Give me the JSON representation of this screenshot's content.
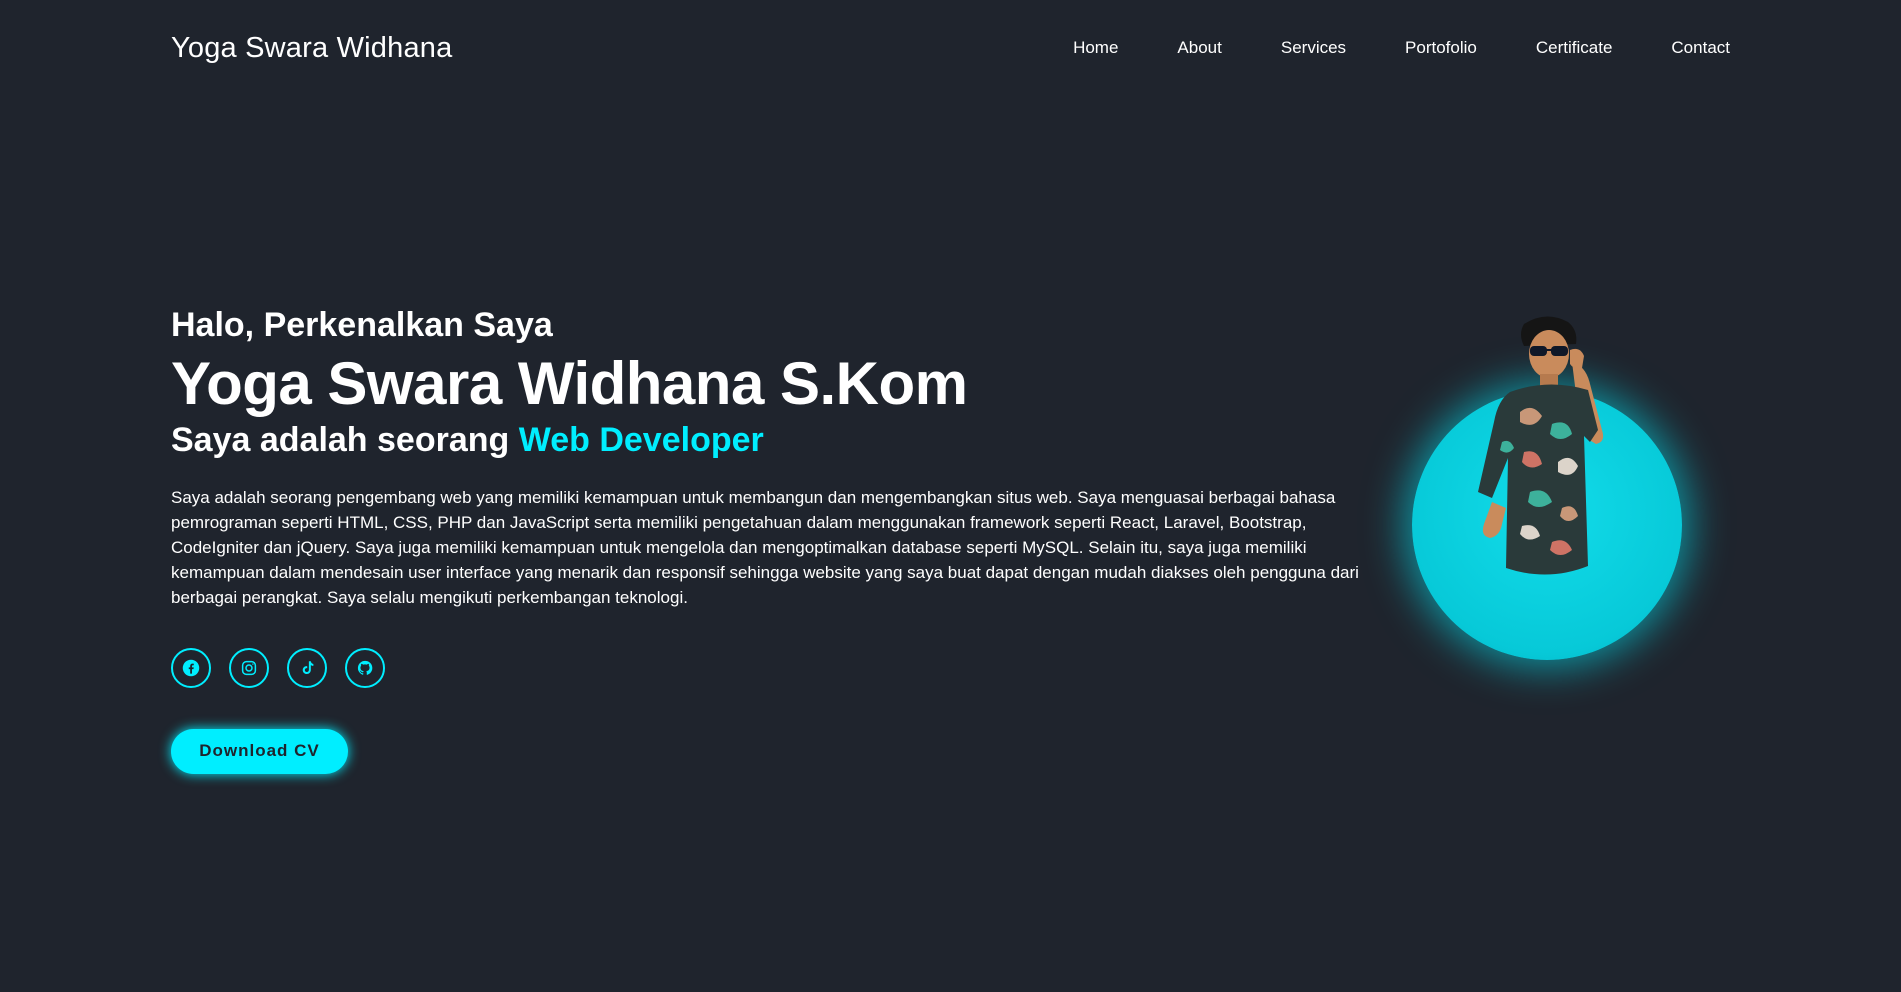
{
  "header": {
    "logo": "Yoga Swara Widhana",
    "nav": [
      {
        "label": "Home"
      },
      {
        "label": "About"
      },
      {
        "label": "Services"
      },
      {
        "label": "Portofolio"
      },
      {
        "label": "Certificate"
      },
      {
        "label": "Contact"
      }
    ]
  },
  "hero": {
    "greeting": "Halo, Perkenalkan Saya",
    "name": "Yoga Swara Widhana S.Kom",
    "role_prefix": "Saya adalah seorang ",
    "role_highlight": "Web Developer",
    "description": "Saya adalah seorang pengembang web yang memiliki kemampuan untuk membangun dan mengembangkan situs web. Saya menguasai berbagai bahasa pemrograman seperti HTML, CSS, PHP dan JavaScript serta memiliki pengetahuan dalam menggunakan framework seperti React, Laravel, Bootstrap, CodeIgniter dan jQuery. Saya juga memiliki kemampuan untuk mengelola dan mengoptimalkan database seperti MySQL. Selain itu, saya juga memiliki kemampuan dalam mendesain user interface yang menarik dan responsif sehingga website yang saya buat dapat dengan mudah diakses oleh pengguna dari berbagai perangkat. Saya selalu mengikuti perkembangan teknologi.",
    "socials": [
      {
        "icon": "facebook-icon"
      },
      {
        "icon": "instagram-icon"
      },
      {
        "icon": "tiktok-icon"
      },
      {
        "icon": "github-icon"
      }
    ],
    "cta_label": "Download CV"
  },
  "colors": {
    "background": "#1f242d",
    "accent": "#00eeff",
    "text": "#ffffff"
  }
}
